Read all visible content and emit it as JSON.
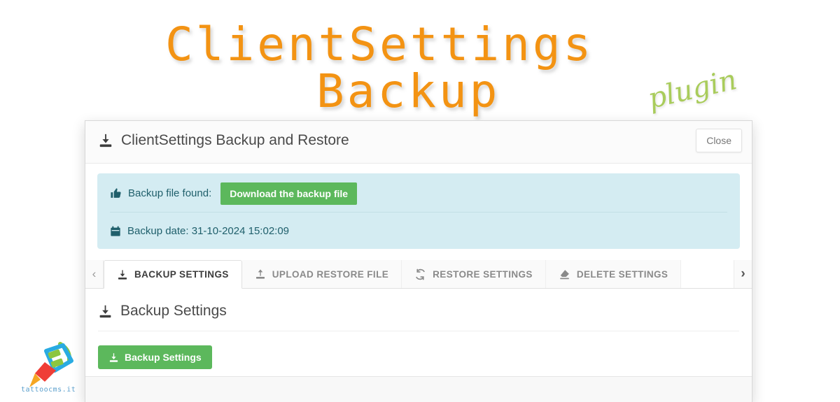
{
  "banner": {
    "line1": "ClientSettings",
    "line2": "Backup",
    "plugin_label": "plugin",
    "title_color": "#f39313",
    "plugin_color": "#a9cc5b"
  },
  "logo": {
    "caption": "tattoocms.it",
    "caption_color": "#3f8fc4"
  },
  "panel": {
    "header": {
      "title": "ClientSettings Backup and Restore",
      "icon": "download-box-icon",
      "close_label": "Close"
    },
    "alert": {
      "found_icon": "thumbs-up-icon",
      "found_label": "Backup file found:",
      "download_label": "Download the backup file",
      "date_icon": "calendar-icon",
      "date_label": "Backup date: 31-10-2024 15:02:09",
      "background_color": "#d4ecf2",
      "text_color": "#1f5f6b",
      "button_color": "#5cb85c"
    },
    "tabs": {
      "scroll_left": "‹",
      "scroll_right": "›",
      "items": [
        {
          "label": "BACKUP SETTINGS",
          "icon": "download-box-icon",
          "active": true
        },
        {
          "label": "UPLOAD RESTORE FILE",
          "icon": "upload-box-icon",
          "active": false
        },
        {
          "label": "RESTORE SETTINGS",
          "icon": "refresh-icon",
          "active": false
        },
        {
          "label": "DELETE SETTINGS",
          "icon": "eraser-icon",
          "active": false
        }
      ]
    },
    "content": {
      "heading": "Backup Settings",
      "heading_icon": "download-box-icon",
      "action_label": "Backup Settings",
      "action_icon": "download-box-icon",
      "action_color": "#5cb85c"
    }
  }
}
